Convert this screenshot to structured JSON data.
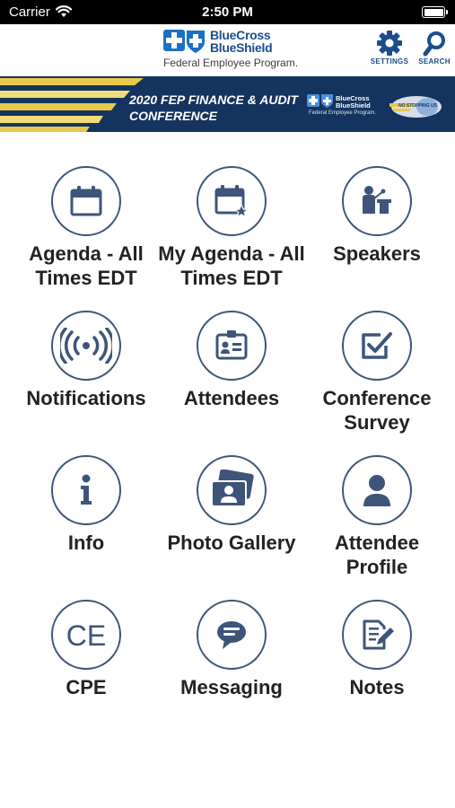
{
  "status_bar": {
    "carrier": "Carrier",
    "time": "2:50 PM"
  },
  "header": {
    "logo_line1": "BlueCross",
    "logo_line2": "BlueShield",
    "logo_line3": "Federal Employee Program.",
    "settings_label": "SETTINGS",
    "search_label": "SEARCH",
    "brand_color": "#1d4d8c"
  },
  "banner": {
    "title_line1": "2020 FEP FINANCE & AUDIT",
    "title_line2": "CONFERENCE",
    "mini_logo_line1": "BlueCross",
    "mini_logo_line2": "BlueShield",
    "mini_logo_line3": "Federal Employee Program.",
    "emblem_text": "NO STOPPING US",
    "background_color": "#14345f",
    "stripe_color": "#e8c94a"
  },
  "tiles": [
    {
      "label": "Agenda - All Times EDT",
      "icon": "calendar-icon"
    },
    {
      "label": "My Agenda - All Times EDT",
      "icon": "calendar-star-icon"
    },
    {
      "label": "Speakers",
      "icon": "speaker-podium-icon"
    },
    {
      "label": "Notifications",
      "icon": "broadcast-icon"
    },
    {
      "label": "Attendees",
      "icon": "id-badge-icon"
    },
    {
      "label": "Conference Survey",
      "icon": "checkbox-icon"
    },
    {
      "label": "Info",
      "icon": "info-icon"
    },
    {
      "label": "Photo Gallery",
      "icon": "photo-gallery-icon"
    },
    {
      "label": "Attendee Profile",
      "icon": "person-icon"
    },
    {
      "label": "CPE",
      "icon": "ce-icon"
    },
    {
      "label": "Messaging",
      "icon": "chat-bubble-icon"
    },
    {
      "label": "Notes",
      "icon": "notepad-icon"
    }
  ],
  "icon_color": "#3e5579"
}
